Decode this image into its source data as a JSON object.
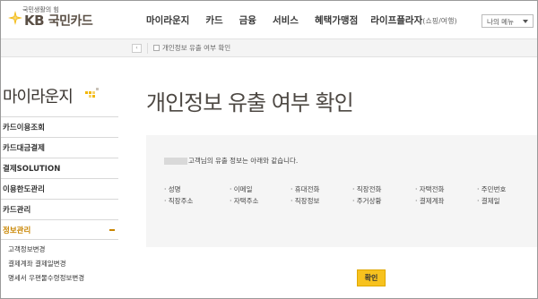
{
  "header": {
    "tagline": "국민생활의 힘",
    "brand_kb": "KB",
    "brand_card": "국민카드",
    "nav": [
      {
        "label": "마이라운지",
        "sub": ""
      },
      {
        "label": "카드",
        "sub": ""
      },
      {
        "label": "금융",
        "sub": ""
      },
      {
        "label": "서비스",
        "sub": ""
      },
      {
        "label": "혜택가맹점",
        "sub": ""
      },
      {
        "label": "라이프플라자",
        "sub": "(쇼핑/여행)"
      }
    ],
    "my_menu": "나의 메뉴"
  },
  "breadcrumb": {
    "home_glyph": "‹",
    "current": "개인정보 유출 여부 확인"
  },
  "sidebar": {
    "title": "마이라운지",
    "items": [
      {
        "label": "카드이용조회"
      },
      {
        "label": "카드대금결제"
      },
      {
        "label": "결제SOLUTION"
      },
      {
        "label": "이용한도관리"
      },
      {
        "label": "카드관리"
      },
      {
        "label": "정보관리"
      }
    ],
    "sub_items": [
      {
        "label": "고객정보변경"
      },
      {
        "label": "결제계좌 결제일변경"
      },
      {
        "label": "명세서 우편물수령정보변경"
      }
    ]
  },
  "main": {
    "title": "개인정보 유출 여부 확인",
    "lead": "고객님의 유출 정보는 아래와 같습니다.",
    "fields_row1": [
      "· 성명",
      "· 이메일",
      "· 휴대전화",
      "· 직장전화",
      "· 자택전화",
      "· 주민번호"
    ],
    "fields_row2": [
      "· 직장주소",
      "· 자택주소",
      "· 직장정보",
      "· 주거상황",
      "· 결제계좌",
      "· 결제일"
    ],
    "confirm_label": "확인"
  },
  "colors": {
    "accent": "#f7c21e",
    "brand_brown": "#5a4f45",
    "active_menu": "#c98500"
  }
}
